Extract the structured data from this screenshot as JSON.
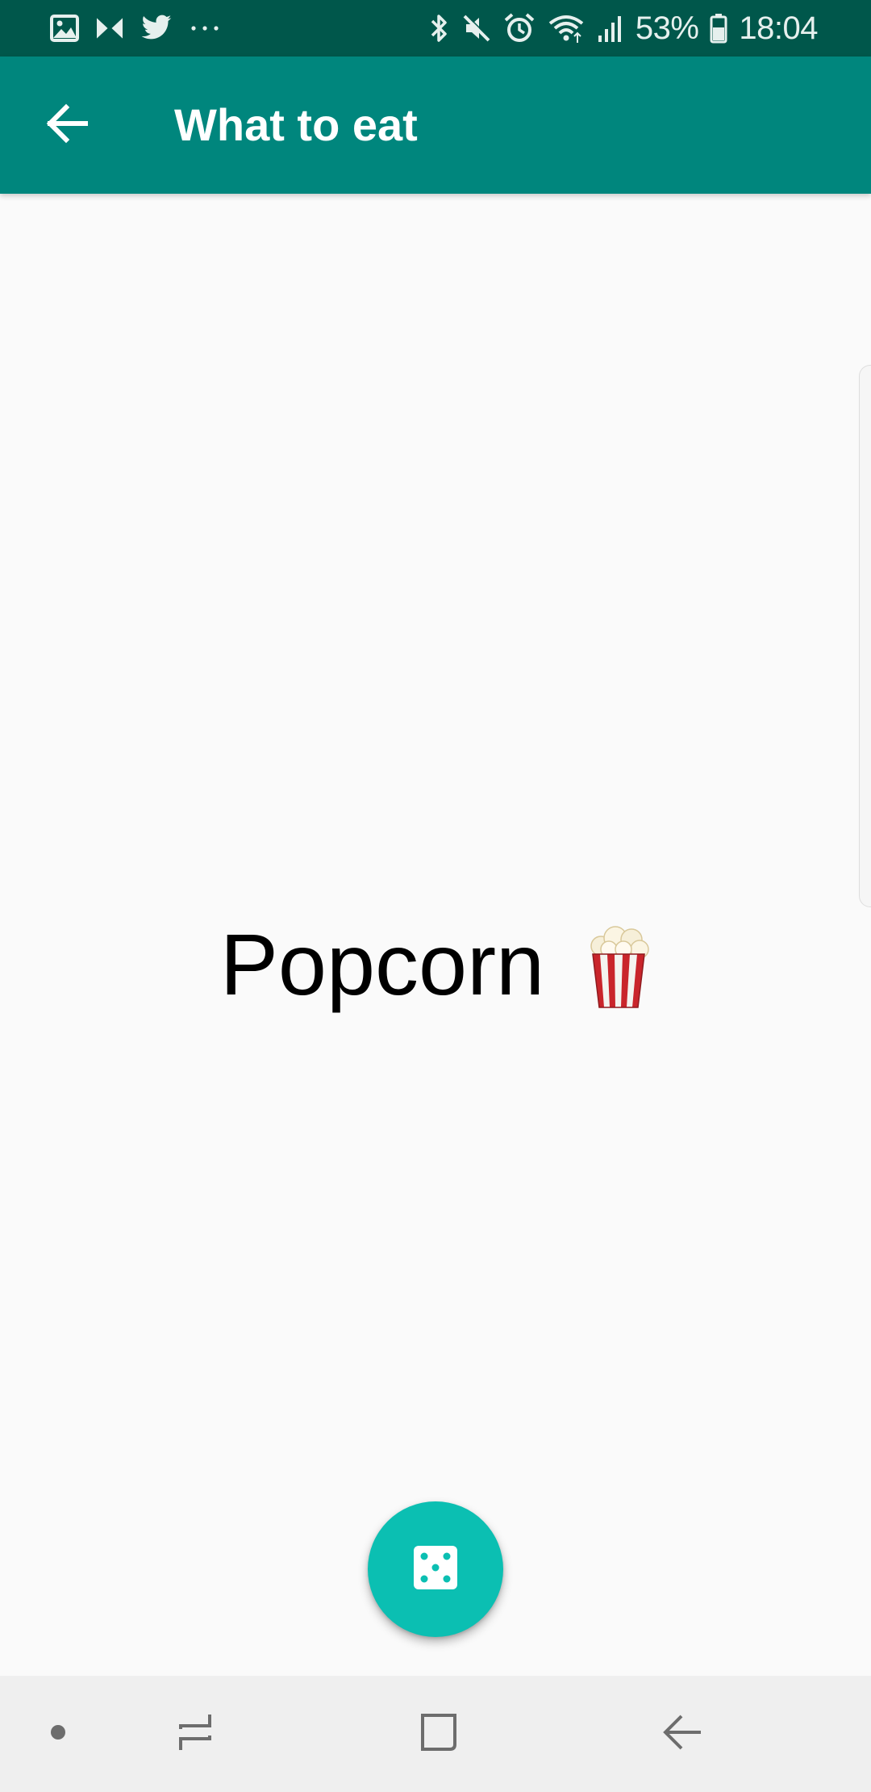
{
  "status_bar": {
    "notification_icons": [
      "gallery-icon",
      "bowtie-app-icon",
      "twitter-icon",
      "more-notifications-icon"
    ],
    "system_icons": [
      "bluetooth-icon",
      "mute-icon",
      "alarm-icon",
      "wifi-icon",
      "signal-icon"
    ],
    "battery_percent": "53%",
    "battery_icon": "battery-icon",
    "time": "18:04"
  },
  "app_bar": {
    "back_icon": "arrow-back-icon",
    "title": "What to eat",
    "background_color": "#00867d"
  },
  "content": {
    "result_text": "Popcorn",
    "result_emoji": "popcorn-emoji",
    "background_color": "#fafafa"
  },
  "fab": {
    "icon": "dice-icon",
    "color": "#0bbfb2"
  },
  "nav_bar": {
    "items": [
      "nav-dot",
      "recent-apps-icon",
      "home-icon",
      "back-icon"
    ]
  }
}
